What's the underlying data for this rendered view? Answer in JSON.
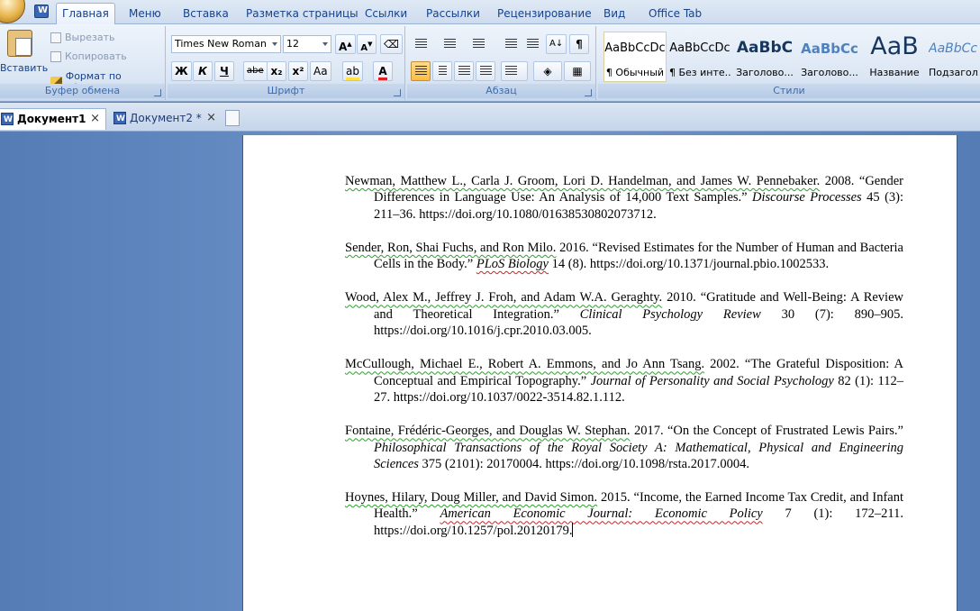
{
  "tabs": [
    "Главная",
    "Меню",
    "Вставка",
    "Разметка страницы",
    "Ссылки",
    "Рассылки",
    "Рецензирование",
    "Вид",
    "Office Tab"
  ],
  "active_tab": "Главная",
  "clipboard": {
    "paste": "Вставить",
    "cut": "Вырезать",
    "copy": "Копировать",
    "format_painter": "Формат по образцу",
    "group_label": "Буфер обмена"
  },
  "font": {
    "name": "Times New Roman",
    "size": "12",
    "grow": "A",
    "shrink": "A",
    "bold": "Ж",
    "italic": "К",
    "underline": "Ч",
    "strike": "abe",
    "subscript": "x₂",
    "superscript": "x²",
    "change_case": "Aa",
    "highlight": "ab",
    "font_color": "A",
    "group_label": "Шрифт"
  },
  "paragraph": {
    "group_label": "Абзац",
    "show_marks": "¶",
    "sort": "A↓"
  },
  "styles": {
    "group_label": "Стили",
    "items": [
      {
        "sample": "AaBbCcDc",
        "name": "¶ Обычный"
      },
      {
        "sample": "AaBbCcDc",
        "name": "¶ Без инте..."
      },
      {
        "sample": "AaBbC",
        "name": "Заголово..."
      },
      {
        "sample": "AaBbCc",
        "name": "Заголово..."
      },
      {
        "sample": "AaB",
        "name": "Название"
      },
      {
        "sample": "AaBbCc",
        "name": "Подзагол..."
      }
    ]
  },
  "doc_tabs": [
    {
      "title": "Документ1 *",
      "close": "×"
    },
    {
      "title": "Документ2 *",
      "close": "×"
    }
  ],
  "references": [
    {
      "authors": "Newman, Matthew L., Carla J. Groom, Lori D. Handelman, and James W. Pennebaker.",
      "pre": " 2008. “Gender Differences in Language Use: An Analysis of 14,000 Text Samples.” ",
      "journal": "Discourse Processes",
      "post": " 45 (3): 211–36. https://doi.org/10.1080/01638530802073712."
    },
    {
      "authors": "Sender, Ron, Shai Fuchs, and Ron Milo.",
      "pre": " 2016. “Revised Estimates for the Number of Human and Bacteria Cells in the Body.” ",
      "journal": "PLoS Biology",
      "post": " 14 (8). https://doi.org/10.1371/journal.pbio.1002533."
    },
    {
      "authors": "Wood, Alex M., Jeffrey J. Froh, and Adam W.A. Geraghty.",
      "pre": " 2010. “Gratitude and Well-Being: A Review and Theoretical Integration.” ",
      "journal": "Clinical Psychology Review",
      "post": " 30 (7): 890–905. https://doi.org/10.1016/j.cpr.2010.03.005."
    },
    {
      "authors": "McCullough, Michael E., Robert A. Emmons, and Jo Ann Tsang.",
      "pre": " 2002. “The Grateful Disposition: A Conceptual and Empirical Topography.” ",
      "journal": "Journal of Personality and Social Psychology",
      "post": " 82 (1): 112–27. https://doi.org/10.1037/0022-3514.82.1.112."
    },
    {
      "authors": "Fontaine, Frédéric-Georges, and Douglas W. Stephan.",
      "pre": " 2017. “On the Concept of Frustrated Lewis Pairs.” ",
      "journal": "Philosophical Transactions of the Royal Society A: Mathematical, Physical and Engineering Sciences",
      "post": " 375 (2101): 20170004. https://doi.org/10.1098/rsta.2017.0004."
    },
    {
      "authors": "Hoynes, Hilary, Doug Miller, and David Simon.",
      "pre": " 2015. “Income, the Earned Income Tax Credit, and Infant Health.” ",
      "journal": "American Economic Journal: Economic Policy",
      "post": " 7 (1): 172–211. https://doi.org/10.1257/pol.20120179."
    }
  ]
}
